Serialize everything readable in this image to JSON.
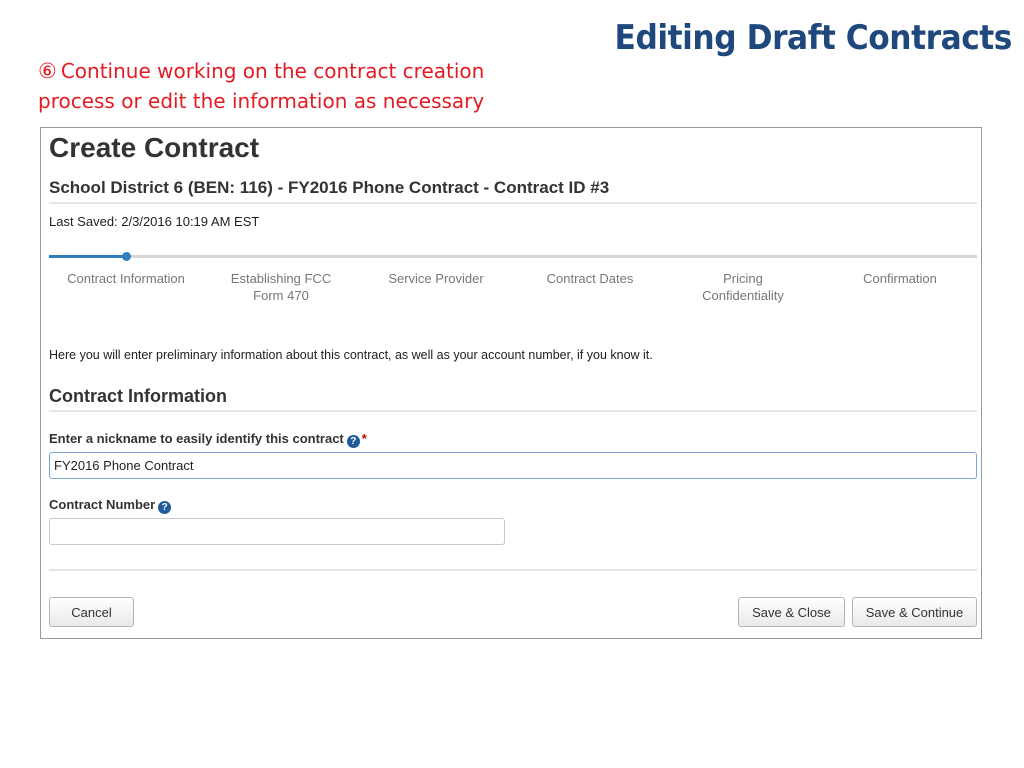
{
  "slide": {
    "title": "Editing Draft Contracts",
    "step_number": "⑥",
    "instruction": "Continue working on the contract creation process or edit the information as necessary"
  },
  "form": {
    "page_title": "Create Contract",
    "subtitle": "School District 6 (BEN: 116) - FY2016 Phone Contract - Contract ID #3",
    "last_saved": "Last Saved: 2/3/2016 10:19 AM EST",
    "progress_fraction": 0.083,
    "steps": [
      {
        "label": "Contract Information",
        "active": true
      },
      {
        "label": "Establishing FCC Form 470",
        "active": false
      },
      {
        "label": "Service Provider",
        "active": false
      },
      {
        "label": "Contract Dates",
        "active": false
      },
      {
        "label": "Pricing Confidentiality",
        "active": false
      },
      {
        "label": "Confirmation",
        "active": false
      }
    ],
    "intro": "Here you will enter preliminary information about this contract, as well as your account number, if you know it.",
    "section_title": "Contract Information",
    "nickname_label": "Enter a nickname to easily identify this contract",
    "nickname_required_mark": "*",
    "nickname_value": "FY2016 Phone Contract",
    "contract_number_label": "Contract Number",
    "contract_number_value": "",
    "help_icon_glyph": "?",
    "buttons": {
      "cancel": "Cancel",
      "save_close": "Save & Close",
      "save_continue": "Save & Continue"
    }
  },
  "colors": {
    "title_blue": "#1f497d",
    "instruction_red": "#e31b23",
    "progress_blue": "#2f7fc1"
  }
}
